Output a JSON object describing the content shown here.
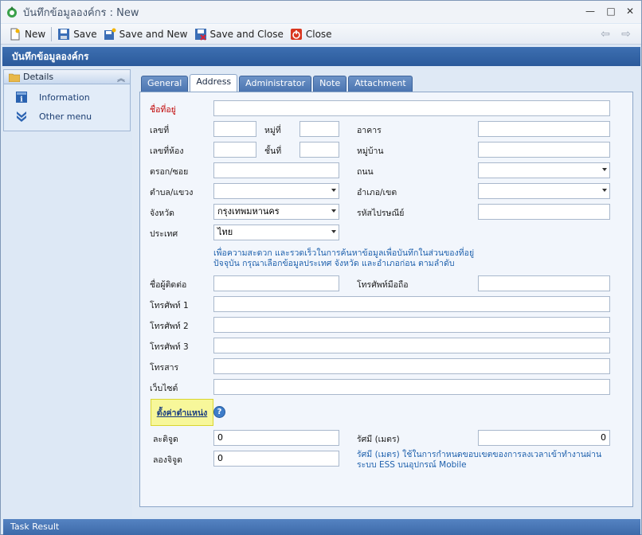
{
  "window": {
    "title": "บันทึกข้อมูลองค์กร : New",
    "controls": [
      "minimize-icon",
      "maximize-icon",
      "close-icon"
    ]
  },
  "toolbar": {
    "new_label": "New",
    "save_label": "Save",
    "save_new_label": "Save and New",
    "save_close_label": "Save and Close",
    "close_label": "Close"
  },
  "header": {
    "title": "บันทึกข้อมูลองค์กร"
  },
  "nav": {
    "section": "Details",
    "items": [
      {
        "label": "Information",
        "icon": "info-icon"
      },
      {
        "label": "Other menu",
        "icon": "chevron-double-down-icon"
      }
    ]
  },
  "tabs": [
    "General",
    "Address",
    "Administrator",
    "Note",
    "Attachment"
  ],
  "active_tab": "Address",
  "form": {
    "place_name": {
      "label": "ชื่อที่อยู่",
      "value": ""
    },
    "house_no": {
      "label": "เลขที่",
      "value": ""
    },
    "moo": {
      "label": "หมู่ที่",
      "value": ""
    },
    "building": {
      "label": "อาคาร",
      "value": ""
    },
    "room_no": {
      "label": "เลขที่ห้อง",
      "value": ""
    },
    "floor": {
      "label": "ชั้นที่",
      "value": ""
    },
    "village": {
      "label": "หมู่บ้าน",
      "value": ""
    },
    "soi": {
      "label": "ตรอก/ซอย",
      "value": ""
    },
    "road": {
      "label": "ถนน",
      "value": ""
    },
    "subdistrict": {
      "label": "ตำบล/แขวง",
      "value": ""
    },
    "district": {
      "label": "อำเภอ/เขต",
      "value": ""
    },
    "province": {
      "label": "จังหวัด",
      "value": "กรุงเทพมหานคร"
    },
    "postcode": {
      "label": "รหัสไปรษณีย์",
      "value": ""
    },
    "country": {
      "label": "ประเทศ",
      "value": "ไทย"
    },
    "note_line1": "เพื่อความสะดวก และรวดเร็วในการค้นหาข้อมูลเพื่อบันทึกในส่วนของที่อยู่",
    "note_line2": "ปัจจุบัน กรุณาเลือกข้อมูลประเทศ จังหวัด และอำเภอก่อน ตามลำดับ",
    "contact_name": {
      "label": "ชื่อผู้ติดต่อ",
      "value": ""
    },
    "mobile": {
      "label": "โทรศัพท์มือถือ",
      "value": ""
    },
    "phone1": {
      "label": "โทรศัพท์ 1",
      "value": ""
    },
    "phone2": {
      "label": "โทรศัพท์ 2",
      "value": ""
    },
    "phone3": {
      "label": "โทรศัพท์ 3",
      "value": ""
    },
    "fax": {
      "label": "โทรสาร",
      "value": ""
    },
    "website": {
      "label": "เว็บไซต์",
      "value": ""
    },
    "set_position_label": "ตั้งค่าตำแหน่ง",
    "latitude": {
      "label": "ละติจูด",
      "value": "0"
    },
    "radius": {
      "label": "รัศมี (เมตร)",
      "value": "0"
    },
    "longitude": {
      "label": "ลองจิจูด",
      "value": "0"
    },
    "radius_note_line1": "รัศมี (เมตร) ใช้ในการกำหนดขอบเขตของการลงเวลาเข้าทำงานผ่าน",
    "radius_note_line2": "ระบบ ESS บนอุปกรณ์ Mobile"
  },
  "taskbar": {
    "label": "Task Result"
  },
  "colors": {
    "header": "#2f5fa2",
    "highlight": "#f7f79a",
    "required": "#c00000",
    "note": "#1f61ad"
  }
}
